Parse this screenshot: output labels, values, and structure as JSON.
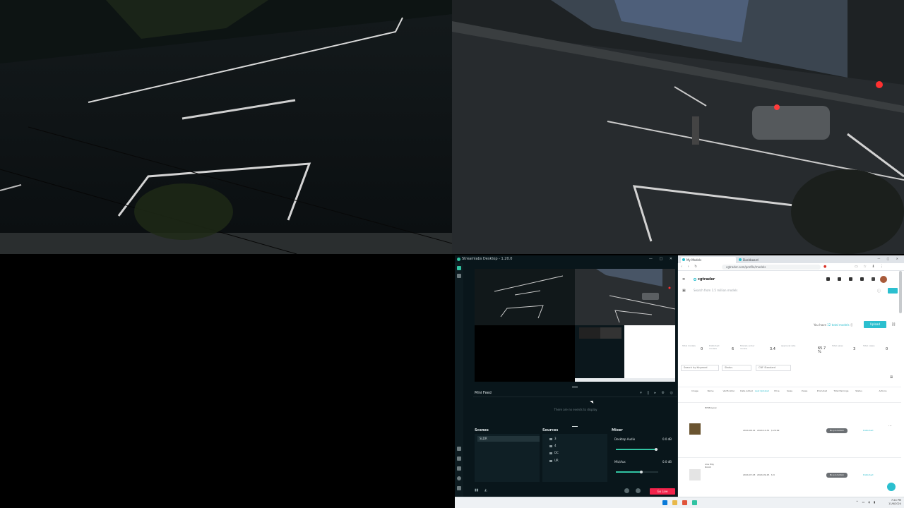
{
  "streamlabs": {
    "title": "Streamlabs Desktop - 1.20.0",
    "window_controls": "— □ ✕",
    "minifeed": {
      "title": "Mini Feed",
      "empty_text": "There are no events to display"
    },
    "scenes": {
      "title": "Scenes",
      "items": [
        "SLDR"
      ]
    },
    "sources": {
      "title": "Sources",
      "items": [
        "3",
        "4",
        "DC",
        "UR"
      ]
    },
    "mixer": {
      "title": "Mixer",
      "channels": [
        {
          "name": "Desktop Audio",
          "db": "0.0 dB",
          "level": 0.95
        },
        {
          "name": "Mic/Aux",
          "db": "0.0 dB",
          "level": 0.6
        }
      ]
    },
    "go_live_label": "Go Live",
    "accent": "#31c3a2",
    "live_color": "#f3234b"
  },
  "browser": {
    "tabs": [
      {
        "label": "My Models",
        "active": true
      },
      {
        "label": "Dashboard",
        "active": false
      }
    ],
    "url": "cgtrader.com/profile/models",
    "site": {
      "brand": "cgtrader",
      "search_placeholder": "Search from 1.5 million models",
      "your_total_text": "You have",
      "your_total_link": "12 total models",
      "upload_label": "Upload",
      "stats": [
        {
          "label": "Total models",
          "value": "0"
        },
        {
          "label": "Published models",
          "value": "6"
        },
        {
          "label": "Models under review",
          "value": "3.4"
        },
        {
          "label": "Approval rate",
          "value": "65.7 %"
        },
        {
          "label": "Total sales",
          "value": "3"
        },
        {
          "label": "Total views",
          "value": "0"
        }
      ],
      "filters": {
        "keyword_placeholder": "Search by Keyword",
        "status": "Status",
        "license": "CNF Standard"
      },
      "columns": [
        "Image",
        "Name",
        "Verification",
        "Date Added",
        "Last Updated",
        "Price",
        "Sales",
        "Views",
        "Promoted",
        "Total Earnings",
        "Status",
        "Actions"
      ],
      "rows": [
        {
          "name": "Elf Phoenix",
          "added": "2024-08-12",
          "updated": "2024-10-31",
          "price": "$ 29.99",
          "promoted": "No promotion",
          "status": "Published"
        },
        {
          "name": "Low Poly Robot",
          "added": "2024-07-03",
          "updated": "2024-09-15",
          "price": "$ 9",
          "promoted": "No promotion",
          "status": "Published"
        }
      ],
      "brand_color": "#2bbfcf"
    }
  },
  "taskbar": {
    "time": "7:24 PM",
    "date": "11/6/2024"
  }
}
